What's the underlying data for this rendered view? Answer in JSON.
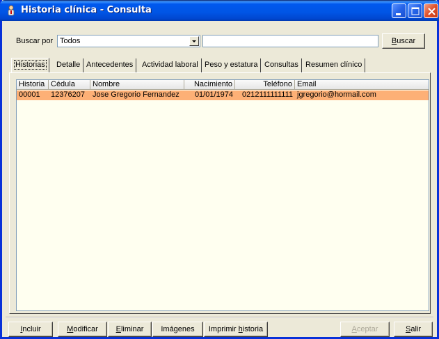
{
  "window": {
    "title": "Historia clínica - Consulta"
  },
  "search": {
    "label": "Buscar por",
    "field_value": "Todos",
    "input_value": "",
    "button_label_u": "B",
    "button_label_rest": "uscar"
  },
  "tabs": [
    {
      "label": "Historias",
      "active": true
    },
    {
      "label": "Detalle"
    },
    {
      "label": "Antecedentes"
    },
    {
      "label": "Actividad laboral"
    },
    {
      "label": "Peso y estatura"
    },
    {
      "label": "Consultas"
    },
    {
      "label": "Resumen clínico"
    }
  ],
  "table": {
    "columns": [
      "Historia",
      "Cédula",
      "Nombre",
      "Nacimiento",
      "Teléfono",
      "Email"
    ],
    "rows": [
      [
        "00001",
        "12376207",
        "Jose Gregorio Fernandez",
        "01/01/1974",
        "0212111111111",
        "jgregorio@hormail.com"
      ]
    ],
    "selected_row_color": "#FDB076"
  },
  "buttons": {
    "incluir": {
      "u": "I",
      "rest": "ncluir"
    },
    "modificar": {
      "u": "M",
      "rest": "odificar"
    },
    "eliminar": {
      "u": "E",
      "rest": "liminar"
    },
    "imagenes": {
      "label": "Imágenes"
    },
    "imprimir": {
      "pre": "Imprimir ",
      "u": "h",
      "rest": "istoria"
    },
    "aceptar": {
      "u": "A",
      "rest": "ceptar",
      "disabled": true
    },
    "salir": {
      "u": "S",
      "rest": "alir"
    }
  },
  "icons": {
    "app": "patient-icon",
    "minimize": "minimize-icon",
    "maximize": "maximize-icon",
    "close": "close-icon",
    "dropdown": "chevron-down-icon"
  },
  "colors": {
    "titlebar": "#0055E5",
    "close_button": "#E0512B",
    "list_background": "#FFFFF0"
  }
}
